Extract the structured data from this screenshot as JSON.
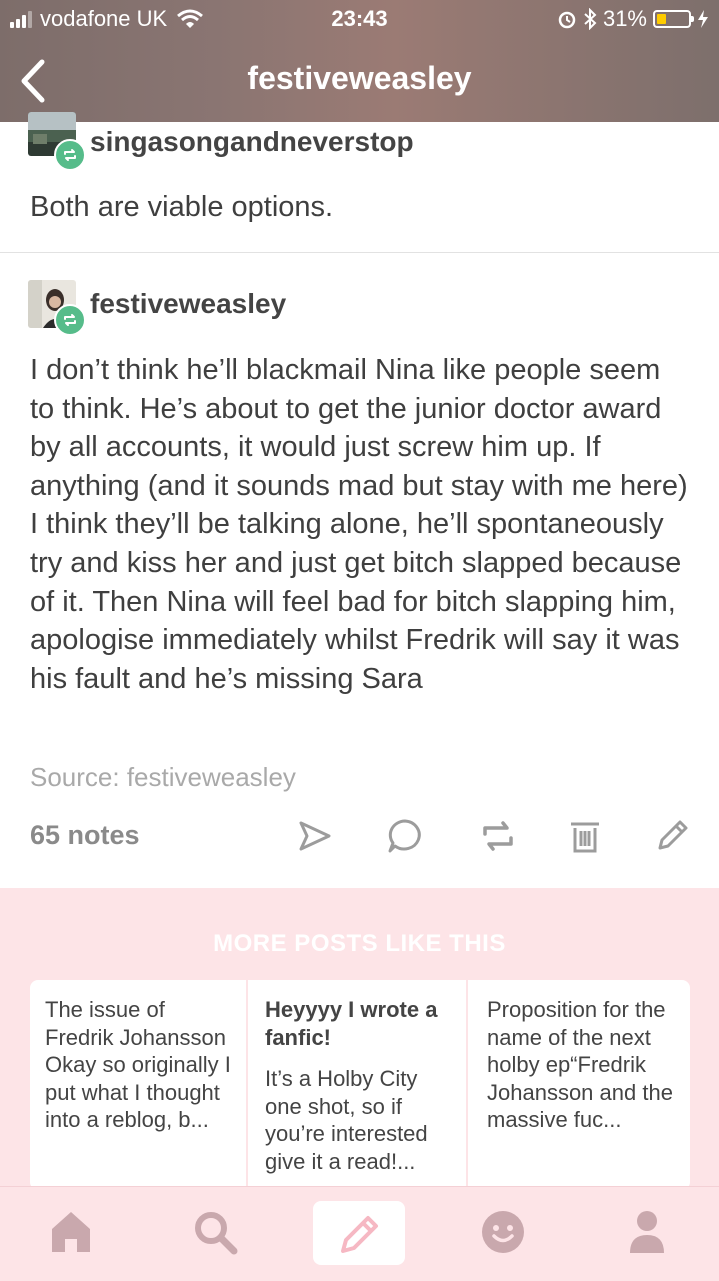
{
  "status_bar": {
    "carrier": "vodafone UK",
    "time": "23:43",
    "battery_percent": "31%",
    "battery_level": 0.31,
    "icons": [
      "signal-icon",
      "wifi-icon",
      "alarm-icon",
      "bluetooth-icon",
      "battery-icon",
      "charging-icon"
    ]
  },
  "header": {
    "title": "festiveweasley",
    "back_icon": "chevron-left-icon"
  },
  "post": {
    "reblog_1": {
      "username": "singasongandneverstop",
      "text": "Both are viable options."
    },
    "reblog_2": {
      "username": "festiveweasley",
      "text": "I don’t think he’ll blackmail Nina like people seem to think. He’s about to get the junior doctor award by all accounts, it would just screw him up. If anything (and it sounds mad but stay with me here) I think they’ll be talking alone, he’ll spontaneously try and kiss her and just get bitch slapped because of it. Then Nina will feel bad for bitch slapping him, apologise immediately whilst Fredrik will say it was his fault and he’s missing Sara"
    },
    "source": "Source: festiveweasley",
    "notes": "65 notes",
    "actions": [
      "share-icon",
      "comment-icon",
      "reblog-icon",
      "delete-icon",
      "edit-icon"
    ]
  },
  "more_posts": {
    "title": "MORE POSTS LIKE THIS",
    "cards": [
      {
        "title": "",
        "text": "The issue of Fredrik Johansson Okay so originally I put what I thought into a reblog, b..."
      },
      {
        "title": "Heyyyy I wrote a fanfic!",
        "text": "It’s a Holby City one shot, so if you’re interested give it a read!..."
      },
      {
        "title": "",
        "text": "Proposition for the name of the next holby ep“Fredrik Johansson and the massive fuc..."
      }
    ]
  },
  "tab_bar": {
    "items": [
      "home-icon",
      "search-icon",
      "compose-icon",
      "activity-icon",
      "account-icon"
    ],
    "color": "#c9a8ad"
  },
  "colors": {
    "reblog_badge": "#56bc8a",
    "more_bg": "#fde4e7",
    "compose_pencil": "#f6b8c3"
  }
}
